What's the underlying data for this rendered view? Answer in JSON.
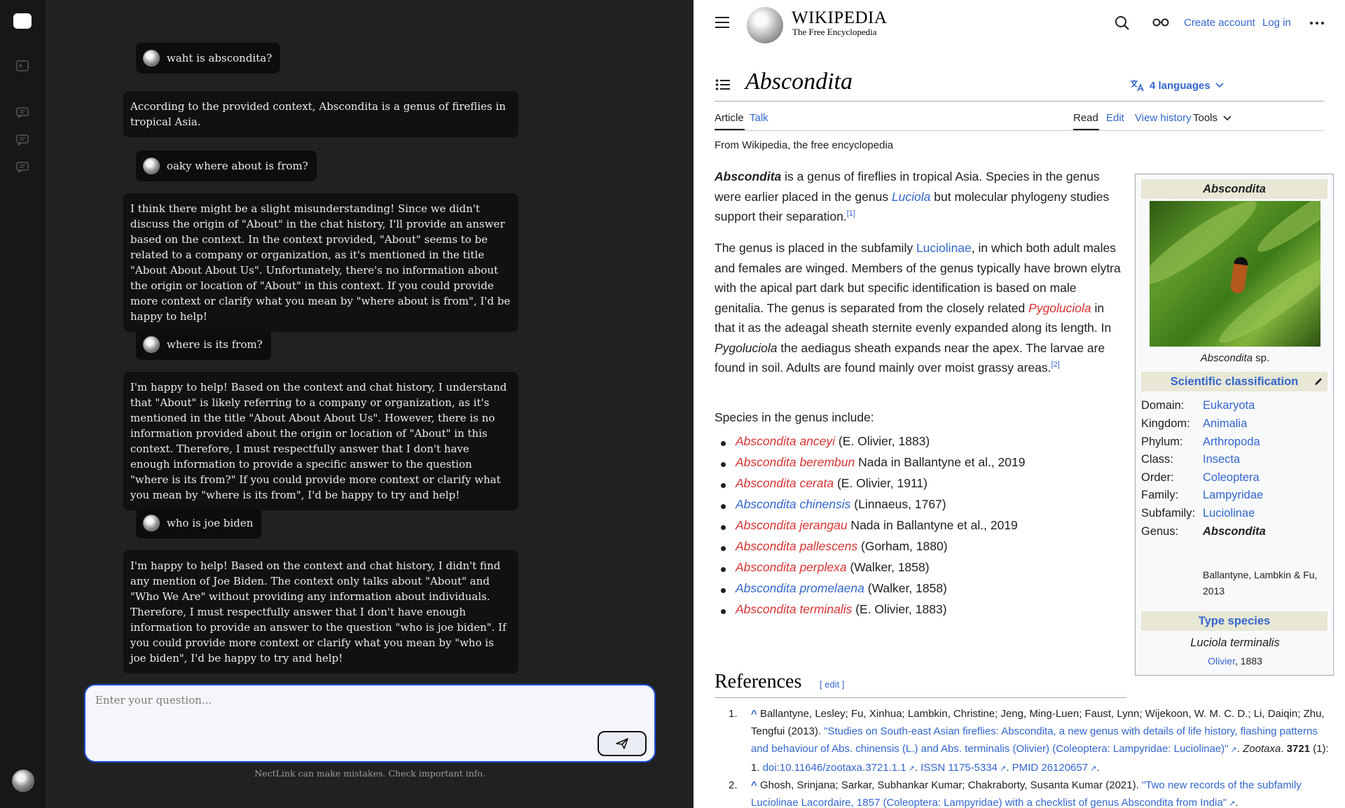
{
  "chat": {
    "messages": [
      {
        "role": "user",
        "text": "waht is abscondita?"
      },
      {
        "role": "assistant",
        "text": "According to the provided context, Abscondita is a genus of fireflies in tropical Asia."
      },
      {
        "role": "user",
        "text": "oaky where about is from?"
      },
      {
        "role": "assistant",
        "text": "I think there might be a slight misunderstanding! Since we didn't discuss the origin of \"About\" in the chat history, I'll provide an answer based on the context. In the context provided, \"About\" seems to be related to a company or organization, as it's mentioned in the title \"About About About Us\". Unfortunately, there's no information about the origin or location of \"About\" in this context. If you could provide more context or clarify what you mean by \"where about is from\", I'd be happy to help!"
      },
      {
        "role": "user",
        "text": "where is its from?"
      },
      {
        "role": "assistant",
        "text": "I'm happy to help! Based on the context and chat history, I understand that \"About\" is likely referring to a company or organization, as it's mentioned in the title \"About About About Us\". However, there is no information provided about the origin or location of \"About\" in this context. Therefore, I must respectfully answer that I don't have enough information to provide a specific answer to the question \"where is its from?\" If you could provide more context or clarify what you mean by \"where is its from\", I'd be happy to try and help!"
      },
      {
        "role": "user",
        "text": "who is joe biden"
      },
      {
        "role": "assistant",
        "text": "I'm happy to help! Based on the context and chat history, I didn't find any mention of Joe Biden. The context only talks about \"About\" and \"Who We Are\" without providing any information about individuals. Therefore, I must respectfully answer that I don't have enough information to provide an answer to the question \"who is joe biden\". If you could provide more context or clarify what you mean by \"who is joe biden\", I'd be happy to try and help!"
      }
    ],
    "input": {
      "placeholder": "Enter your question...",
      "value": ""
    },
    "disclaimer": "NectLink can make mistakes. Check important info."
  },
  "wiki": {
    "wordmark": "WIKIPEDIA",
    "tagline": "The Free Encyclopedia",
    "create_account": "Create account",
    "login": "Log in",
    "title": "Abscondita",
    "languages": "4 languages",
    "tabs": {
      "article": "Article",
      "talk": "Talk",
      "read": "Read",
      "edit": "Edit",
      "history": "View history",
      "tools": "Tools"
    },
    "from": "From Wikipedia, the free encyclopedia",
    "p1": {
      "bold": "Abscondita",
      "t1": " is a genus of fireflies in tropical Asia. Species in the genus were earlier placed in the genus ",
      "link": "Luciola",
      "t2": " but molecular phylogeny studies support their separation.",
      "ref": "[1]"
    },
    "p2": {
      "t1": "The genus is placed in the subfamily ",
      "link1": "Luciolinae",
      "t2": ", in which both adult males and females are winged. Members of the genus typically have brown elytra with the apical part dark but specific identification is based on male genitalia. The genus is separated from the closely related ",
      "link2": "Pygoluciola",
      "t3": " in that it as the adeagal sheath sternite evenly expanded along its length. In ",
      "ital": "Pygoluciola",
      "t4": " the aediagus sheath expands near the apex. The larvae are found in soil. Adults are found mainly over moist grassy areas.",
      "ref": "[2]"
    },
    "species_intro": "Species in the genus include:",
    "species": [
      {
        "name": "Abscondita anceyi",
        "author": " (E. Olivier, 1883)",
        "exists": false
      },
      {
        "name": "Abscondita berembun",
        "author": " Nada in Ballantyne et al., 2019",
        "exists": false
      },
      {
        "name": "Abscondita cerata",
        "author": " (E. Olivier, 1911)",
        "exists": false
      },
      {
        "name": "Abscondita chinensis",
        "author": " (Linnaeus, 1767)",
        "exists": true
      },
      {
        "name": "Abscondita jerangau",
        "author": " Nada in Ballantyne et al., 2019",
        "exists": false
      },
      {
        "name": "Abscondita pallescens",
        "author": " (Gorham, 1880)",
        "exists": false
      },
      {
        "name": "Abscondita perplexa",
        "author": " (Walker, 1858)",
        "exists": false
      },
      {
        "name": "Abscondita promelaena",
        "author": " (Walker, 1858)",
        "exists": true
      },
      {
        "name": "Abscondita terminalis",
        "author": " (E. Olivier, 1883)",
        "exists": false
      }
    ],
    "infobox": {
      "title": "Abscondita",
      "caption_ital": "Abscondita",
      "caption_rest": " sp.",
      "sci_class": "Scientific classification",
      "rows": [
        {
          "k": "Domain:",
          "v": "Eukaryota"
        },
        {
          "k": "Kingdom:",
          "v": "Animalia"
        },
        {
          "k": "Phylum:",
          "v": "Arthropoda"
        },
        {
          "k": "Class:",
          "v": "Insecta"
        },
        {
          "k": "Order:",
          "v": "Coleoptera"
        },
        {
          "k": "Family:",
          "v": "Lampyridae"
        },
        {
          "k": "Subfamily:",
          "v": "Luciolinae"
        }
      ],
      "genus_k": "Genus:",
      "genus_v": "Abscondita",
      "genus_author": "Ballantyne, Lambkin & Fu, 2013",
      "type_species_head": "Type species",
      "type_species": "Luciola terminalis",
      "type_author_link": "Olivier",
      "type_author_year": ", 1883"
    },
    "references": {
      "heading": "References",
      "edit": "[ edit ]",
      "items": [
        {
          "n": "1.",
          "authors": "Ballantyne, Lesley; Fu, Xinhua; Lambkin, Christine; Jeng, Ming-Luen; Faust, Lynn; Wijekoon, W. M. C. D.; Li, Daiqin; Zhu, Tengfui (2013). ",
          "title": "\"Studies on South-east Asian fireflies: Abscondita, a new genus with details of life history, flashing patterns and behaviour of Abs. chinensis (L.) and Abs. terminalis (Olivier) (Coleoptera: Lampyridae: Luciolinae)\"",
          "journal": "Zootaxa",
          "vol": "3721",
          "rest": " (1): 1. ",
          "doi": "doi:10.11646/zootaxa.3721.1.1",
          "issn": "ISSN 1175-5334",
          "pmid": "PMID 26120657"
        },
        {
          "n": "2.",
          "authors": "Ghosh, Srinjana; Sarkar, Subhankar Kumar; Chakraborty, Susanta Kumar (2021). ",
          "title": "\"Two new records of the subfamily Luciolinae Lacordaire, 1857 (Coleoptera: Lampyridae) with a checklist of genus Abscondita from India\""
        }
      ]
    }
  }
}
